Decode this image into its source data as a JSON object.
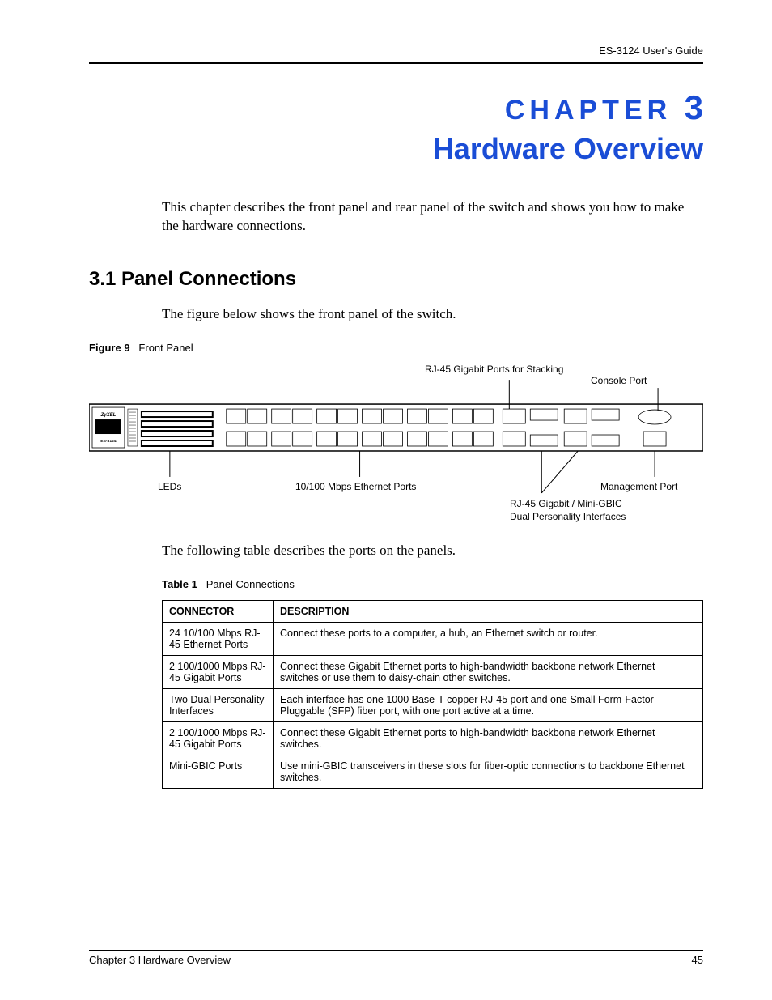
{
  "header": {
    "guide": "ES-3124 User's Guide"
  },
  "chapter": {
    "label": "CHAPTER",
    "number": "3",
    "title": "Hardware Overview"
  },
  "intro": "This chapter describes the front panel and rear panel of the switch and shows you how to make the hardware connections.",
  "section": {
    "num_title": "3.1  Panel Connections",
    "lead": "The figure below shows the front panel of the switch."
  },
  "figure": {
    "caption_label": "Figure 9",
    "caption_text": "Front Panel",
    "model_line1": "ZyXEL",
    "model_line2": "ES-3124",
    "callouts": {
      "stacking": "RJ-45 Gigabit Ports for Stacking",
      "console": "Console Port",
      "leds": "LEDs",
      "eth": "10/100 Mbps Ethernet Ports",
      "mgmt": "Management Port",
      "dual1": "RJ-45 Gigabit / Mini-GBIC",
      "dual2": "Dual Personality Interfaces"
    }
  },
  "table_intro": "The following table describes the ports on the panels.",
  "table": {
    "caption_label": "Table 1",
    "caption_text": "Panel Connections",
    "headers": {
      "c1": "CONNECTOR",
      "c2": "DESCRIPTION"
    },
    "rows": [
      {
        "connector": "24 10/100 Mbps RJ-45 Ethernet Ports",
        "desc": "Connect these ports to a computer, a hub, an Ethernet switch or router.",
        "indent": false
      },
      {
        "connector": "2 100/1000 Mbps RJ-45 Gigabit Ports",
        "desc": "Connect these Gigabit Ethernet ports to high-bandwidth backbone network Ethernet switches or use them to daisy-chain other switches.",
        "indent": false
      },
      {
        "connector": "Two Dual Personality Interfaces",
        "desc": "Each interface has one 1000 Base-T copper RJ-45 port and one Small Form-Factor Pluggable (SFP) fiber port, with one port active at a time.",
        "indent": false
      },
      {
        "connector": "2 100/1000 Mbps RJ-45 Gigabit Ports",
        "desc": "Connect these Gigabit Ethernet ports to high-bandwidth backbone network Ethernet switches.",
        "indent": true
      },
      {
        "connector": "Mini-GBIC Ports",
        "desc": "Use mini-GBIC transceivers in these slots for fiber-optic connections to backbone Ethernet switches.",
        "indent": true
      }
    ]
  },
  "footer": {
    "left": "Chapter 3 Hardware Overview",
    "right": "45"
  }
}
